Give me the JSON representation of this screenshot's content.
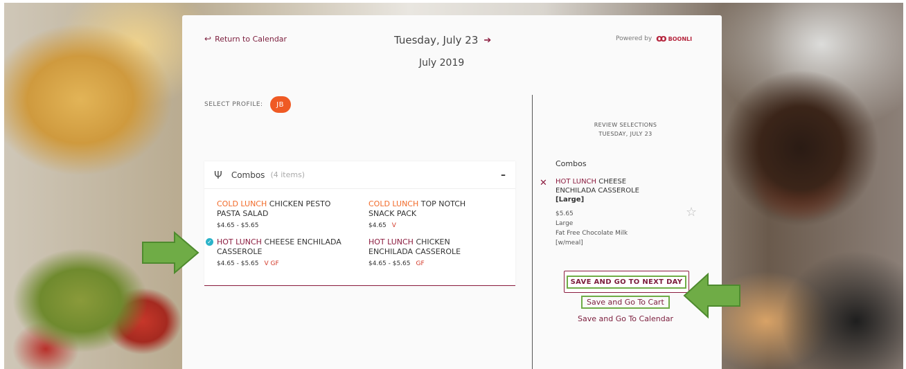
{
  "header": {
    "return_label": "Return to Calendar",
    "day_title": "Tuesday, July 23",
    "month_title": "July 2019",
    "powered_by": "Powered by",
    "brand": "BOONLI"
  },
  "profile": {
    "label": "SELECT PROFILE:",
    "initials": "JB"
  },
  "combos": {
    "title": "Combos",
    "count": "(4 items)",
    "collapse": "–",
    "items": [
      {
        "category": "COLD LUNCH",
        "name": " CHICKEN PESTO PASTA SALAD",
        "price": "$4.65 - $5.65",
        "tags": ""
      },
      {
        "category": "COLD LUNCH",
        "name": " TOP NOTCH SNACK PACK",
        "price": "$4.65",
        "tags": "V"
      },
      {
        "category": "HOT LUNCH",
        "name": " CHEESE ENCHILADA CASSEROLE",
        "price": "$4.65 - $5.65",
        "tags": "V   GF"
      },
      {
        "category": "HOT LUNCH",
        "name": " CHICKEN ENCHILADA CASSEROLE",
        "price": "$4.65 - $5.65",
        "tags": "GF"
      }
    ]
  },
  "review": {
    "title_line1": "REVIEW SELECTIONS",
    "title_line2": "TUESDAY, JULY 23",
    "section": "Combos",
    "selection": {
      "category": "HOT LUNCH",
      "name": " CHEESE ENCHILADA CASSEROLE",
      "size_tag": "[Large]",
      "price": "$5.65",
      "size": "Large",
      "addon": "Fat Free Chocolate Milk",
      "addon_note": "[w/meal]"
    }
  },
  "actions": {
    "next_day": "SAVE AND GO TO NEXT DAY",
    "cart": "Save and Go To Cart",
    "calendar": "Save and Go To Calendar"
  },
  "colors": {
    "brand": "#8b1c3f",
    "cold": "#f26b2a",
    "annotation": "#6fac46"
  }
}
